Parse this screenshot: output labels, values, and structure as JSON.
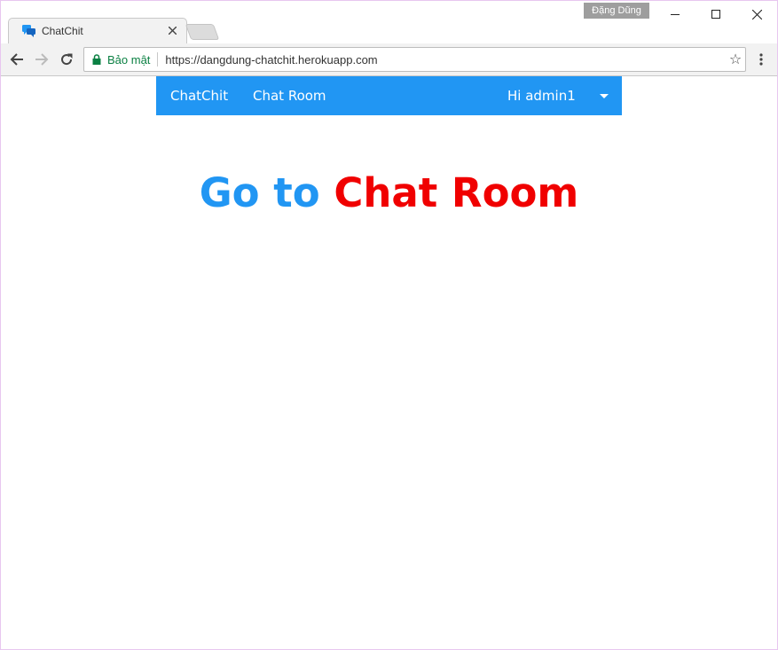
{
  "window": {
    "user_badge": "Đặng Dũng"
  },
  "tab": {
    "title": "ChatChit",
    "close_glyph": "✕"
  },
  "toolbar": {
    "secure_label": "Bảo mật",
    "url": "https://dangdung-chatchit.herokuapp.com",
    "star_glyph": "☆"
  },
  "navbar": {
    "brand": "ChatChit",
    "links": [
      "Chat Room"
    ],
    "user_greeting": "Hi admin1",
    "color": "#2196f3"
  },
  "hero": {
    "part1": "Go to",
    "part2": "Chat Room",
    "color_part1": "#2196f3",
    "color_part2": "#f00000"
  },
  "icons": {
    "favicon": "chat-bubbles-icon",
    "back": "arrow-left-icon",
    "forward": "arrow-right-icon",
    "reload": "reload-icon",
    "lock": "lock-icon",
    "bookmark": "star-icon",
    "menu": "kebab-menu-icon",
    "minimize": "minimize-icon",
    "maximize": "maximize-icon",
    "close": "close-icon",
    "dropdown": "caret-down-icon"
  }
}
